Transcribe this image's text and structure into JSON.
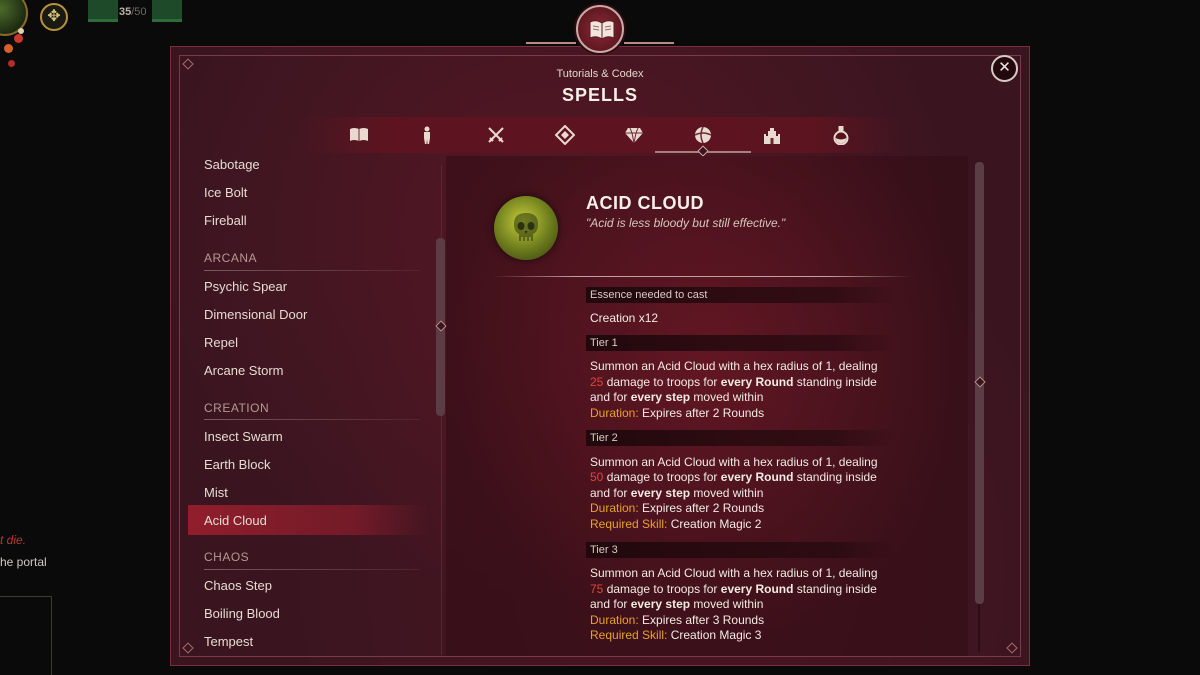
{
  "hud": {
    "troop_count": "35",
    "troop_max": "/50",
    "log_line1": "t die.",
    "log_line2": "he portal"
  },
  "header": {
    "subtitle": "Tutorials & Codex",
    "title": "SPELLS",
    "close_label": "✕"
  },
  "tabs": [
    {
      "name": "tab-book",
      "icon": "book-icon"
    },
    {
      "name": "tab-unit",
      "icon": "soldier-icon"
    },
    {
      "name": "tab-combat",
      "icon": "crossed-swords-icon"
    },
    {
      "name": "tab-diamond",
      "icon": "diamond-icon"
    },
    {
      "name": "tab-gems",
      "icon": "gem-icon"
    },
    {
      "name": "tab-spells",
      "icon": "magic-orb-icon",
      "active": true
    },
    {
      "name": "tab-castle",
      "icon": "castle-icon"
    },
    {
      "name": "tab-potion",
      "icon": "potion-icon"
    }
  ],
  "spell_list": {
    "items_top": [
      "Sabotage",
      "Ice Bolt",
      "Fireball"
    ],
    "arcana_header": "ARCANA",
    "arcana": [
      "Psychic Spear",
      "Dimensional Door",
      "Repel",
      "Arcane Storm"
    ],
    "creation_header": "CREATION",
    "creation": [
      "Insect Swarm",
      "Earth Block",
      "Mist",
      "Acid Cloud"
    ],
    "chaos_header": "CHAOS",
    "chaos": [
      "Chaos Step",
      "Boiling Blood",
      "Tempest"
    ],
    "selected": "Acid Cloud"
  },
  "detail": {
    "name": "ACID CLOUD",
    "quote": "\"Acid is less bloody but still effective.\"",
    "essence_label": "Essence needed to cast",
    "essence_value": "Creation x12",
    "tiers": [
      {
        "label": "Tier 1",
        "line1": "Summon an Acid Cloud with a hex radius of 1, dealing",
        "damage": "25",
        "line2a": " damage to troops for ",
        "line2b": "every Round",
        "line2c": " standing inside",
        "line3a": "and for ",
        "line3b": "every step",
        "line3c": " moved within",
        "duration_label": "Duration:",
        "duration_value": " Expires after 2 Rounds"
      },
      {
        "label": "Tier 2",
        "line1": "Summon an Acid Cloud with a hex radius of 1, dealing",
        "damage": "50",
        "line2a": " damage to troops for ",
        "line2b": "every Round",
        "line2c": " standing inside",
        "line3a": "and for ",
        "line3b": "every step",
        "line3c": " moved within",
        "duration_label": "Duration:",
        "duration_value": " Expires after 2 Rounds",
        "skill_label": "Required Skill:",
        "skill_value": " Creation Magic 2"
      },
      {
        "label": "Tier 3",
        "line1": "Summon an Acid Cloud with a hex radius of 1, dealing",
        "damage": "75",
        "line2a": " damage to troops for ",
        "line2b": "every Round",
        "line2c": " standing inside",
        "line3a": "and for ",
        "line3b": "every step",
        "line3c": " moved within",
        "duration_label": "Duration:",
        "duration_value": " Expires after 3 Rounds",
        "skill_label": "Required Skill:",
        "skill_value": " Creation Magic 3"
      }
    ]
  },
  "colors": {
    "panel": "#3a1520",
    "selected": "#961e2d",
    "damage": "#e0463a",
    "keyword": "#e6a12c"
  }
}
